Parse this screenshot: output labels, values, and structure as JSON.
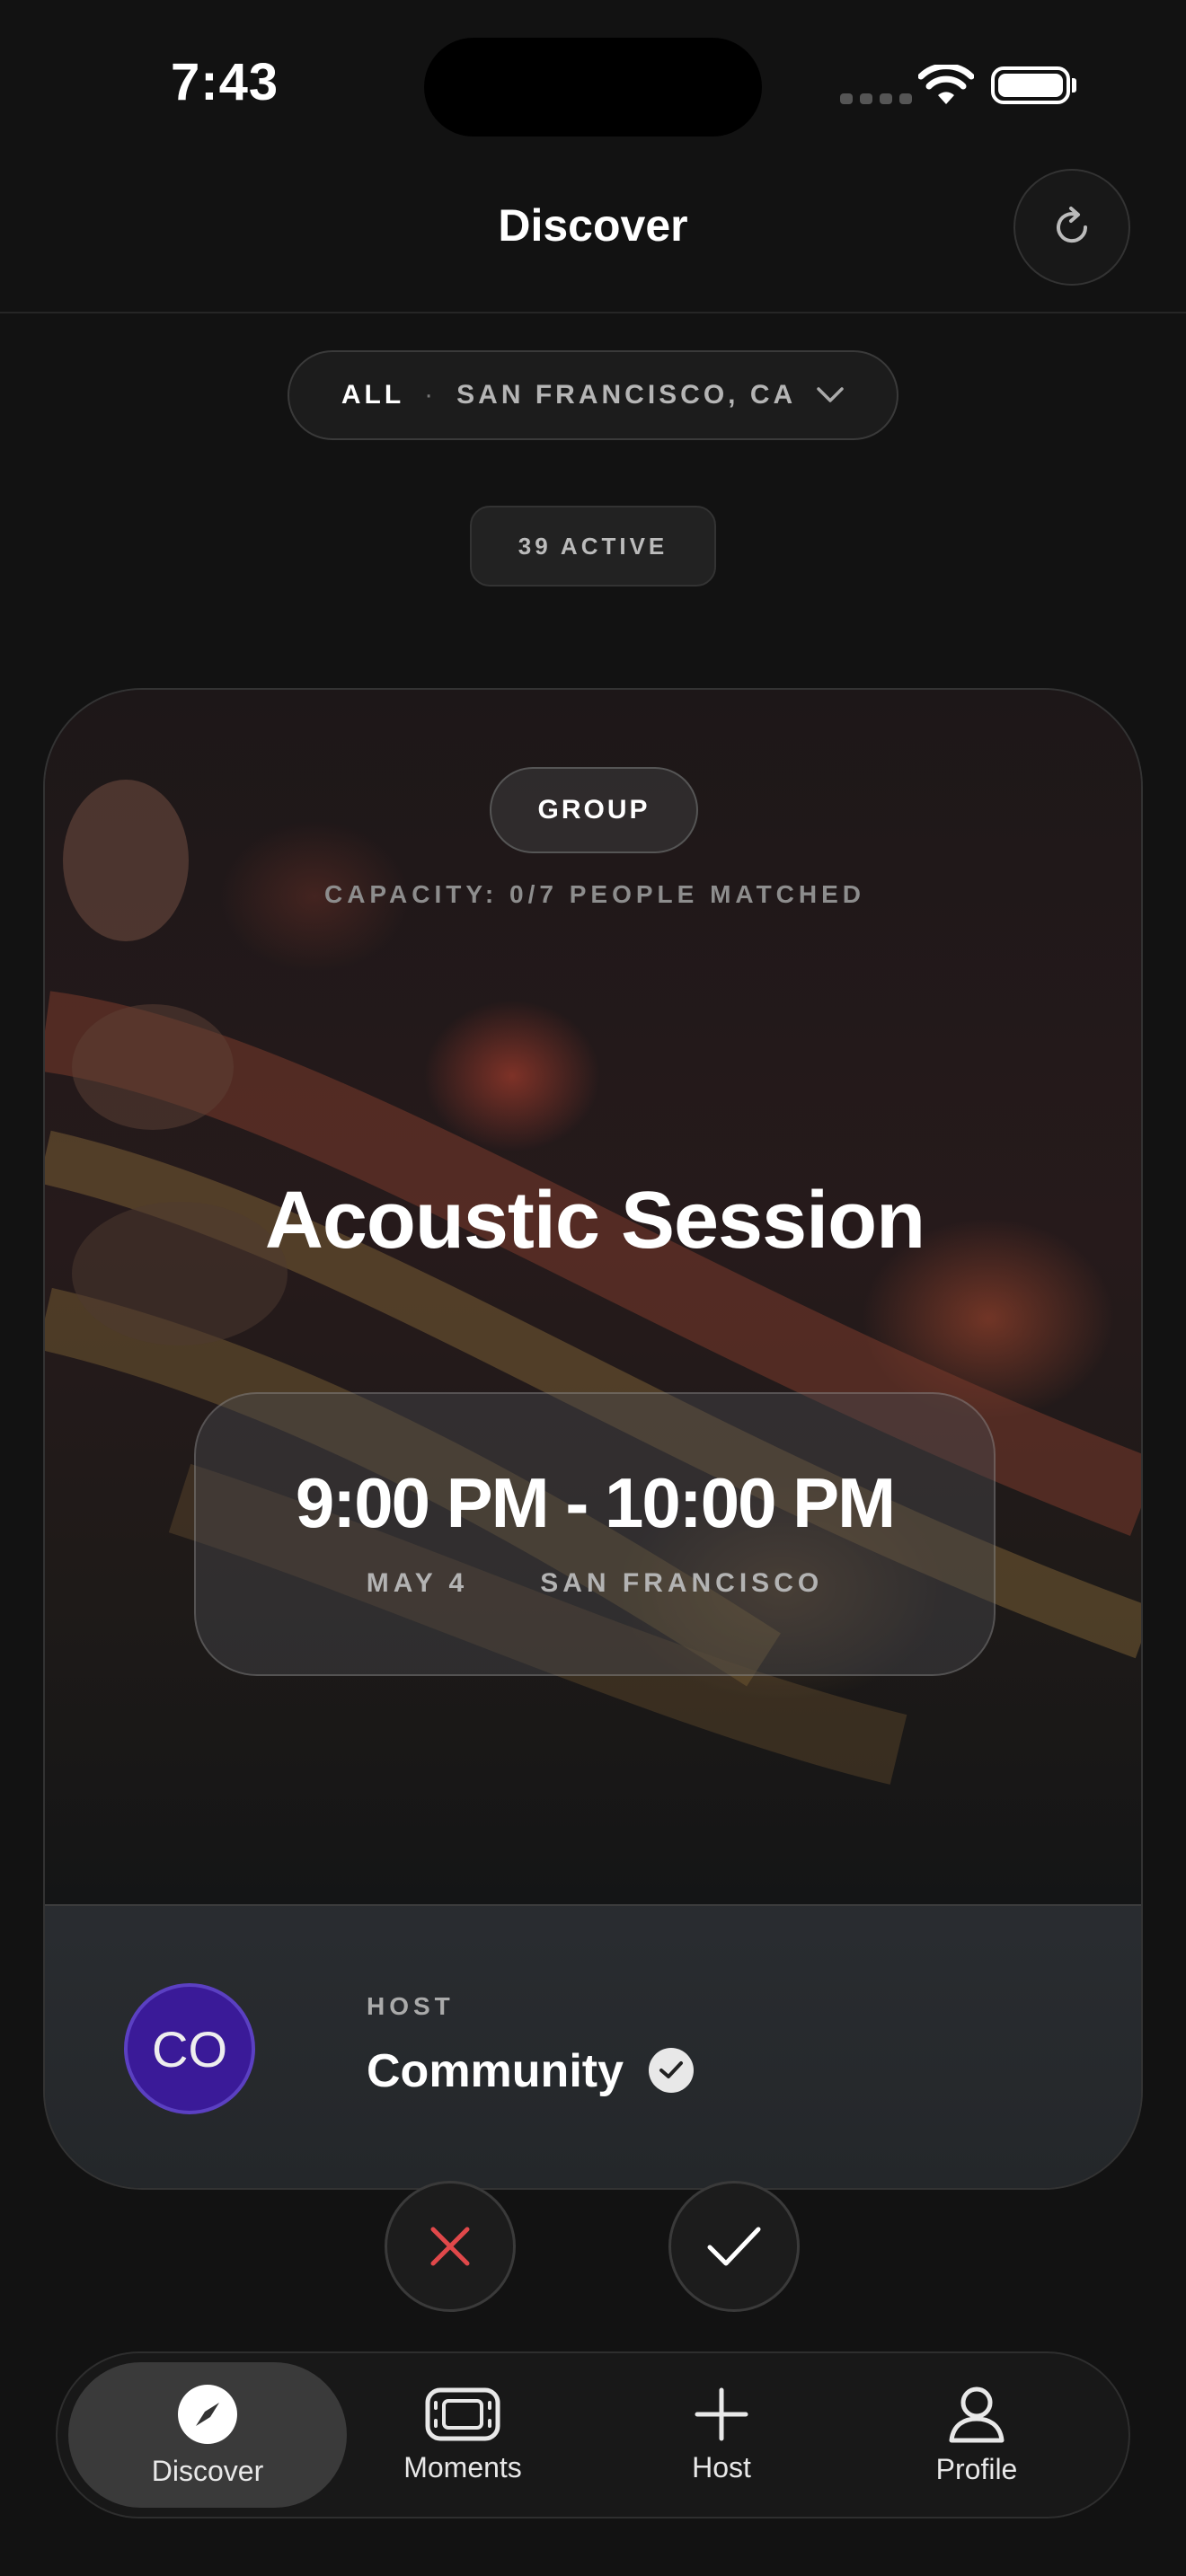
{
  "status_bar": {
    "time": "7:43"
  },
  "header": {
    "title": "Discover"
  },
  "filter": {
    "category": "ALL",
    "separator": "·",
    "location": "SAN FRANCISCO, CA"
  },
  "active_count": "39 ACTIVE",
  "card": {
    "type_label": "GROUP",
    "capacity": "CAPACITY: 0/7 PEOPLE MATCHED",
    "title": "Acoustic Session",
    "time_range": "9:00 PM - 10:00 PM",
    "date": "MAY 4",
    "city": "SAN FRANCISCO",
    "host": {
      "label": "HOST",
      "name": "Community",
      "initials": "CO",
      "verified": true
    }
  },
  "colors": {
    "reject": "#e0484a",
    "avatar_bg": "#3a1a98",
    "background": "#121212"
  },
  "tabs": [
    {
      "label": "Discover",
      "icon": "compass-icon",
      "selected": true
    },
    {
      "label": "Moments",
      "icon": "ticket-icon",
      "selected": false
    },
    {
      "label": "Host",
      "icon": "plus-icon",
      "selected": false
    },
    {
      "label": "Profile",
      "icon": "person-icon",
      "selected": false
    }
  ]
}
